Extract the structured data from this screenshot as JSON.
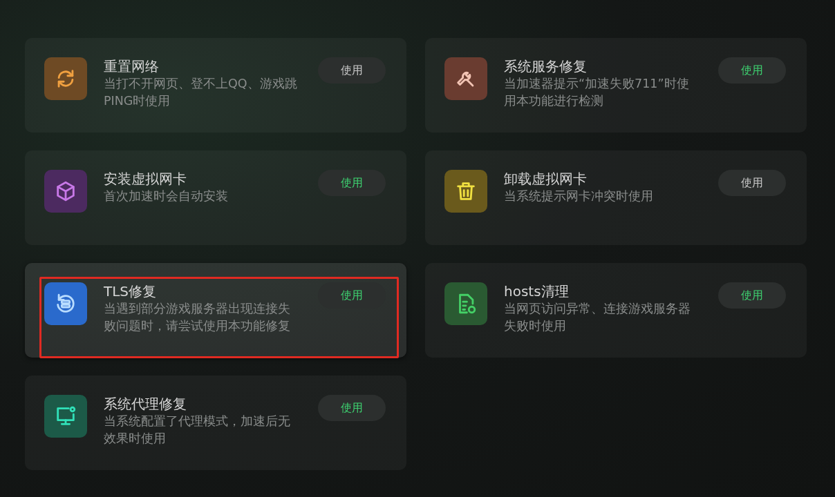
{
  "tools": [
    {
      "kind": "refresh",
      "color": "#6e4a24",
      "title": "重置网络",
      "description": "当打不开网页、登不上QQ、游戏跳PING时使用",
      "button": "使用",
      "active": false,
      "selected": false,
      "outlined": false
    },
    {
      "kind": "wrench",
      "color": "#6a3c30",
      "title": "系统服务修复",
      "description": "当加速器提示“加速失败711”时使用本功能进行检测",
      "button": "使用",
      "active": true,
      "selected": false,
      "outlined": false
    },
    {
      "kind": "cube",
      "color": "#4c2a60",
      "title": "安装虚拟网卡",
      "description": "首次加速时会自动安装",
      "button": "使用",
      "active": true,
      "selected": false,
      "outlined": false
    },
    {
      "kind": "trash",
      "color": "#6a5a1c",
      "title": "卸载虚拟网卡",
      "description": "当系统提示网卡冲突时使用",
      "button": "使用",
      "active": false,
      "selected": false,
      "outlined": false
    },
    {
      "kind": "sync",
      "color": "#2a6acc",
      "title": "TLS修复",
      "description": "当遇到部分游戏服务器出现连接失败问题时，请尝试使用本功能修复",
      "button": "使用",
      "active": true,
      "selected": true,
      "outlined": true
    },
    {
      "kind": "document",
      "color": "#2a5a32",
      "title": "hosts清理",
      "description": "当网页访问异常、连接游戏服务器失败时使用",
      "button": "使用",
      "active": true,
      "selected": false,
      "outlined": false
    },
    {
      "kind": "monitor",
      "color": "#1c5a48",
      "title": "系统代理修复",
      "description": "当系统配置了代理模式，加速后无效果时使用",
      "button": "使用",
      "active": true,
      "selected": false,
      "outlined": false
    }
  ]
}
